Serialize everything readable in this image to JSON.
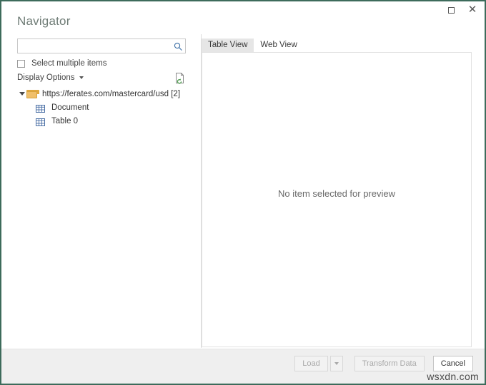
{
  "window": {
    "title": "Navigator",
    "controls": {
      "maximize": "Maximize",
      "close": "Close"
    }
  },
  "left_pane": {
    "search": {
      "value": "",
      "placeholder": "",
      "icon": "search-icon"
    },
    "select_multiple_label": "Select multiple items",
    "select_multiple_checked": false,
    "display_options_label": "Display Options",
    "refresh_icon": "page-refresh-icon",
    "tree": {
      "root": {
        "label": "https://ferates.com/mastercard/usd [2]",
        "icon": "folder-icon",
        "expanded": true
      },
      "children": [
        {
          "label": "Document",
          "icon": "table-icon"
        },
        {
          "label": "Table 0",
          "icon": "table-icon"
        }
      ]
    }
  },
  "right_pane": {
    "tabs": [
      {
        "label": "Table View",
        "active": true
      },
      {
        "label": "Web View",
        "active": false
      }
    ],
    "preview_message": "No item selected for preview"
  },
  "footer": {
    "load_label": "Load",
    "load_enabled": false,
    "load_dropdown_icon": "chevron-down-icon",
    "transform_label": "Transform Data",
    "transform_enabled": false,
    "cancel_label": "Cancel",
    "cancel_enabled": true
  },
  "watermark": "wsxdn.com",
  "colors": {
    "window_border": "#3d6b5b",
    "title_text": "#6e7b75",
    "active_tab_bg": "#e6e6e6",
    "footer_bg": "#efefef",
    "folder": "#f0bf6a",
    "table_icon": "#4a6fa5"
  }
}
